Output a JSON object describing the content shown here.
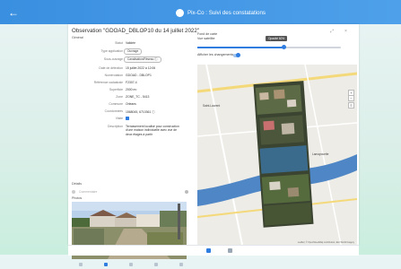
{
  "app": {
    "title": "Pix-Co : Suivi des constatations",
    "back_icon": "arrow-left-icon",
    "logo_icon": "app-logo-icon"
  },
  "observation": {
    "title": "Observation \"GDOAD_DBLOP10 du 14 juillet 2022\"",
    "section": "Général",
    "fields": [
      {
        "label": "Statut",
        "value": "Validée",
        "kind": "text"
      },
      {
        "label": "Type application",
        "value": "Ouvrage",
        "kind": "chip"
      },
      {
        "label": "Sous-ouvrage",
        "value": "Canalisation/Réseau ⓘ",
        "kind": "chip"
      },
      {
        "label": "Date de détection",
        "value": "15 juillet 2022 à 12:06",
        "kind": "text"
      },
      {
        "label": "Numérotation",
        "value": "GDOAD - DBLOP1",
        "kind": "text"
      },
      {
        "label": "Référence cadastrale",
        "value": "F2307-4",
        "kind": "text"
      },
      {
        "label": "Superficie",
        "value": "2000 m²",
        "kind": "text"
      },
      {
        "label": "Zone",
        "value": "ZONE_TC - 5413",
        "kind": "text"
      },
      {
        "label": "Commune",
        "value": "Orleans",
        "kind": "text"
      },
      {
        "label": "Coordonnées",
        "value": "1568045, 6710361 ⓘ",
        "kind": "text"
      },
      {
        "label": "Visite",
        "value": "",
        "kind": "checkbox"
      },
      {
        "label": "Description",
        "value": "Terrassement localisé pour construction d'une maison individuelle avec vue de deux étages à partir",
        "kind": "multiline"
      }
    ],
    "comments_label": "Détails",
    "comment_placeholder": "Commentaire",
    "photos_label": "Photos"
  },
  "map_panel": {
    "basemap_label": "Fond de carte",
    "opacity_label": "Vue satellite",
    "slider_value_label": "Opacité 60%",
    "slider_value": 0.6,
    "toggle_label": "Afficher les changements",
    "place_name": "Saint-Laurent",
    "place_name_2": "Lamayouette",
    "attribution": "Leaflet | © OpenStreetMap contributors, Esri World Imagery",
    "zoom_in": "+",
    "zoom_out": "−",
    "layers": "≡"
  },
  "icons": {
    "fullscreen": "⤢",
    "close": "×"
  },
  "colors": {
    "accent": "#2f7de1",
    "topbar": "#3a8fe0",
    "river": "#4f86c6",
    "road": "#f4d97a"
  }
}
